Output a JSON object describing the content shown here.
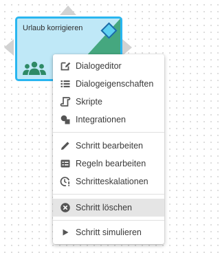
{
  "step": {
    "title": "Urlaub korrigieren",
    "colors": {
      "border": "#29b6f0",
      "fill": "#bfe8f7",
      "accent": "#45a77f",
      "diamond": "#5ed0f2"
    }
  },
  "menu": {
    "items": [
      {
        "label": "Dialogeditor",
        "icon": "edit-dialog-icon"
      },
      {
        "label": "Dialogeigenschaften",
        "icon": "list-icon"
      },
      {
        "label": "Skripte",
        "icon": "script-icon"
      },
      {
        "label": "Integrationen",
        "icon": "shapes-icon"
      },
      {
        "label": "Schritt bearbeiten",
        "icon": "pencil-icon"
      },
      {
        "label": "Regeln bearbeiten",
        "icon": "rules-icon"
      },
      {
        "label": "Schritteskalationen",
        "icon": "clock-alert-icon"
      },
      {
        "label": "Schritt löschen",
        "icon": "delete-circle-icon",
        "highlighted": true
      },
      {
        "label": "Schritt simulieren",
        "icon": "play-icon"
      }
    ]
  }
}
